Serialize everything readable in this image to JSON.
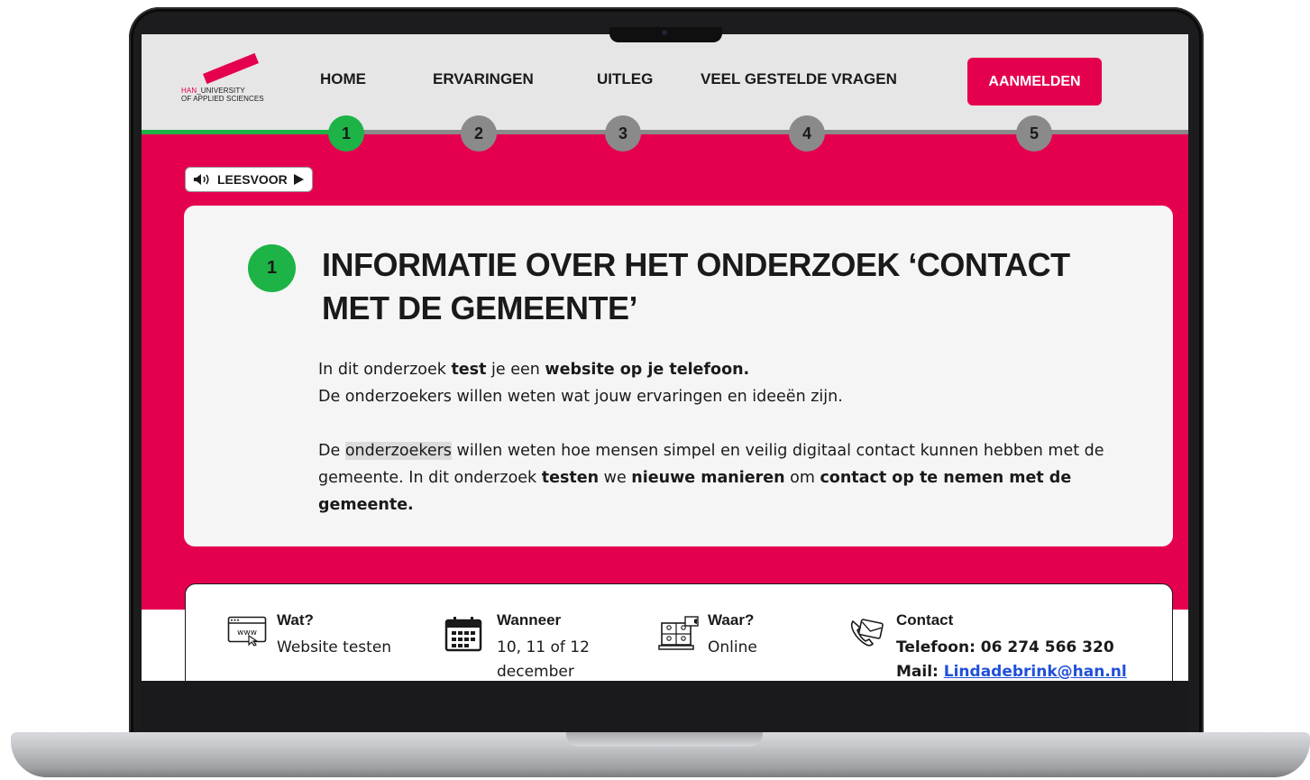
{
  "logo": {
    "line1_prefix": "HAN",
    "line1_rest": "_UNIVERSITY",
    "line2": "OF APPLIED SCIENCES"
  },
  "nav": [
    {
      "label": "HOME"
    },
    {
      "label": "ERVARINGEN"
    },
    {
      "label": "UITLEG"
    },
    {
      "label": "VEEL GESTELDE VRAGEN"
    }
  ],
  "cta_label": "AANMELDEN",
  "steps": [
    "1",
    "2",
    "3",
    "4",
    "5"
  ],
  "read_aloud": {
    "label": "LEESVOOR",
    "icon_speaker": "speaker-icon",
    "icon_play": "play-icon"
  },
  "section": {
    "step_number": "1",
    "title": "INFORMATIE OVER HET ONDERZOEK ‘CONTACT MET DE GEMEENTE’",
    "p1_before": "In dit onderzoek ",
    "p1_bold1": "test",
    "p1_mid": " je een ",
    "p1_bold2": "website op je telefoon.",
    "p2": "De onderzoekers willen weten wat jouw ervaringen en ideeën zijn.",
    "p3_a": "De ",
    "p3_highlight": "onderzoekers",
    "p3_b": " willen weten hoe mensen simpel en veilig digitaal contact kunnen hebben met de gemeente. In dit onderzoek ",
    "p3_bold1": "testen",
    "p3_c": " we ",
    "p3_bold2": "nieuwe manieren",
    "p3_d": " om ",
    "p3_bold3": "contact op te nemen met de gemeente."
  },
  "info": {
    "what": {
      "label": "Wat?",
      "text": "Website testen",
      "icon": "www-icon"
    },
    "when": {
      "label": "Wanneer",
      "text": "10, 11 of 12 december",
      "icon": "calendar-icon"
    },
    "where": {
      "label": "Waar?",
      "text": "Online",
      "icon": "video-call-icon"
    },
    "contact": {
      "label": "Contact",
      "phone": "Telefoon: 06 274 566 320",
      "mail_label": "Mail: ",
      "mail": "Lindadebrink@han.nl",
      "icon": "phone-mail-icon"
    }
  },
  "colors": {
    "brand": "#e5004f",
    "step_active": "#1db346",
    "step_inactive": "#8a8a8a",
    "link": "#2050d8"
  }
}
